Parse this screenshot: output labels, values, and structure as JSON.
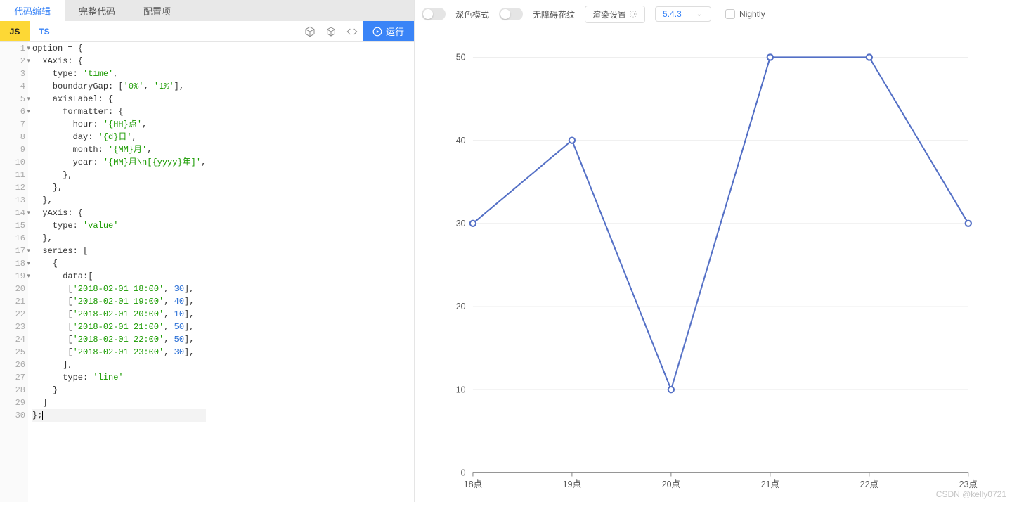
{
  "top_tabs": {
    "edit": "代码编辑",
    "full": "完整代码",
    "config": "配置项"
  },
  "lang": {
    "js": "JS",
    "ts": "TS"
  },
  "run_label": "运行",
  "code_lines": [
    "option = {",
    "  xAxis: {",
    "    type: 'time',",
    "    boundaryGap: ['0%', '1%'],",
    "    axisLabel: {",
    "      formatter: {",
    "        hour: '{HH}点',",
    "        day: '{d}日',",
    "        month: '{MM}月',",
    "        year: '{MM}月\\n[{yyyy}年]',",
    "      },",
    "    },",
    "  },",
    "  yAxis: {",
    "    type: 'value'",
    "  },",
    "  series: [",
    "    {",
    "      data:[",
    "       ['2018-02-01 18:00', 30],",
    "       ['2018-02-01 19:00', 40],",
    "       ['2018-02-01 20:00', 10],",
    "       ['2018-02-01 21:00', 50],",
    "       ['2018-02-01 22:00', 50],",
    "       ['2018-02-01 23:00', 30],",
    "      ],",
    "      type: 'line'",
    "    }",
    "  ]",
    "};"
  ],
  "fold_lines": [
    1,
    2,
    5,
    6,
    14,
    17,
    18,
    19
  ],
  "highlight_line": 30,
  "right_top": {
    "dark_mode": "深色模式",
    "a11y": "无障碍花纹",
    "render": "渲染设置",
    "version": "5.4.3",
    "nightly": "Nightly"
  },
  "watermark": "CSDN @kelly0721",
  "chart_data": {
    "type": "line",
    "categories": [
      "18点",
      "19点",
      "20点",
      "21点",
      "22点",
      "23点"
    ],
    "values": [
      30,
      40,
      10,
      50,
      50,
      30
    ],
    "xlabel": "",
    "ylabel": "",
    "ylim": [
      0,
      50
    ],
    "y_ticks": [
      0,
      10,
      20,
      30,
      40,
      50
    ],
    "series_color": "#5470c6"
  }
}
